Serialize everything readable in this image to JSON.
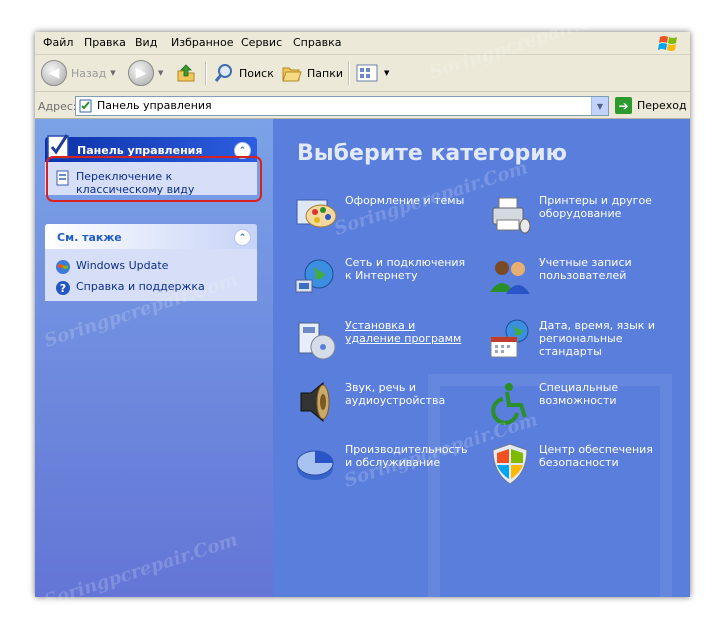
{
  "menu": [
    "Файл",
    "Правка",
    "Вид",
    "Избранное",
    "Сервис",
    "Справка"
  ],
  "toolbar": {
    "back_label": "Назад",
    "search_label": "Поиск",
    "folders_label": "Папки"
  },
  "address": {
    "label": "Адрес:",
    "value": "Панель управления",
    "go_label": "Переход"
  },
  "task_pane": {
    "control_panel": {
      "title": "Панель управления",
      "switch_line1": "Переключение к",
      "switch_line2": "классическому виду"
    },
    "see_also": {
      "title": "См. также",
      "items": [
        "Windows Update",
        "Справка и поддержка"
      ]
    }
  },
  "content": {
    "heading": "Выберите категорию",
    "categories": [
      {
        "l1": "Оформление и темы",
        "l2": "",
        "l3": "",
        "icon": "appearance-icon"
      },
      {
        "l1": "Принтеры и другое",
        "l2": "оборудование",
        "l3": "",
        "icon": "printer-icon"
      },
      {
        "l1": "Сеть и подключения",
        "l2": "к Интернету",
        "l3": "",
        "icon": "network-icon"
      },
      {
        "l1": "Учетные записи",
        "l2": "пользователей",
        "l3": "",
        "icon": "users-icon"
      },
      {
        "l1": "Установка и",
        "l2": "удаление программ",
        "l3": "",
        "icon": "add-remove-icon"
      },
      {
        "l1": "Дата, время, язык и",
        "l2": "региональные",
        "l3": "стандарты",
        "icon": "date-time-icon"
      },
      {
        "l1": "Звук, речь и",
        "l2": "аудиоустройства",
        "l3": "",
        "icon": "sound-icon"
      },
      {
        "l1": "Специальные",
        "l2": "возможности",
        "l3": "",
        "icon": "accessibility-icon"
      },
      {
        "l1": "Производительность",
        "l2": "и обслуживание",
        "l3": "",
        "icon": "performance-icon"
      },
      {
        "l1": "Центр обеспечения",
        "l2": "безопасности",
        "l3": "",
        "icon": "security-shield-icon"
      }
    ]
  },
  "watermark": "Soringpcrepair.Com",
  "colors": {
    "task_pane": "#6f8ce0",
    "content_bg": "#5a7edc",
    "highlight": "#d9211d"
  }
}
